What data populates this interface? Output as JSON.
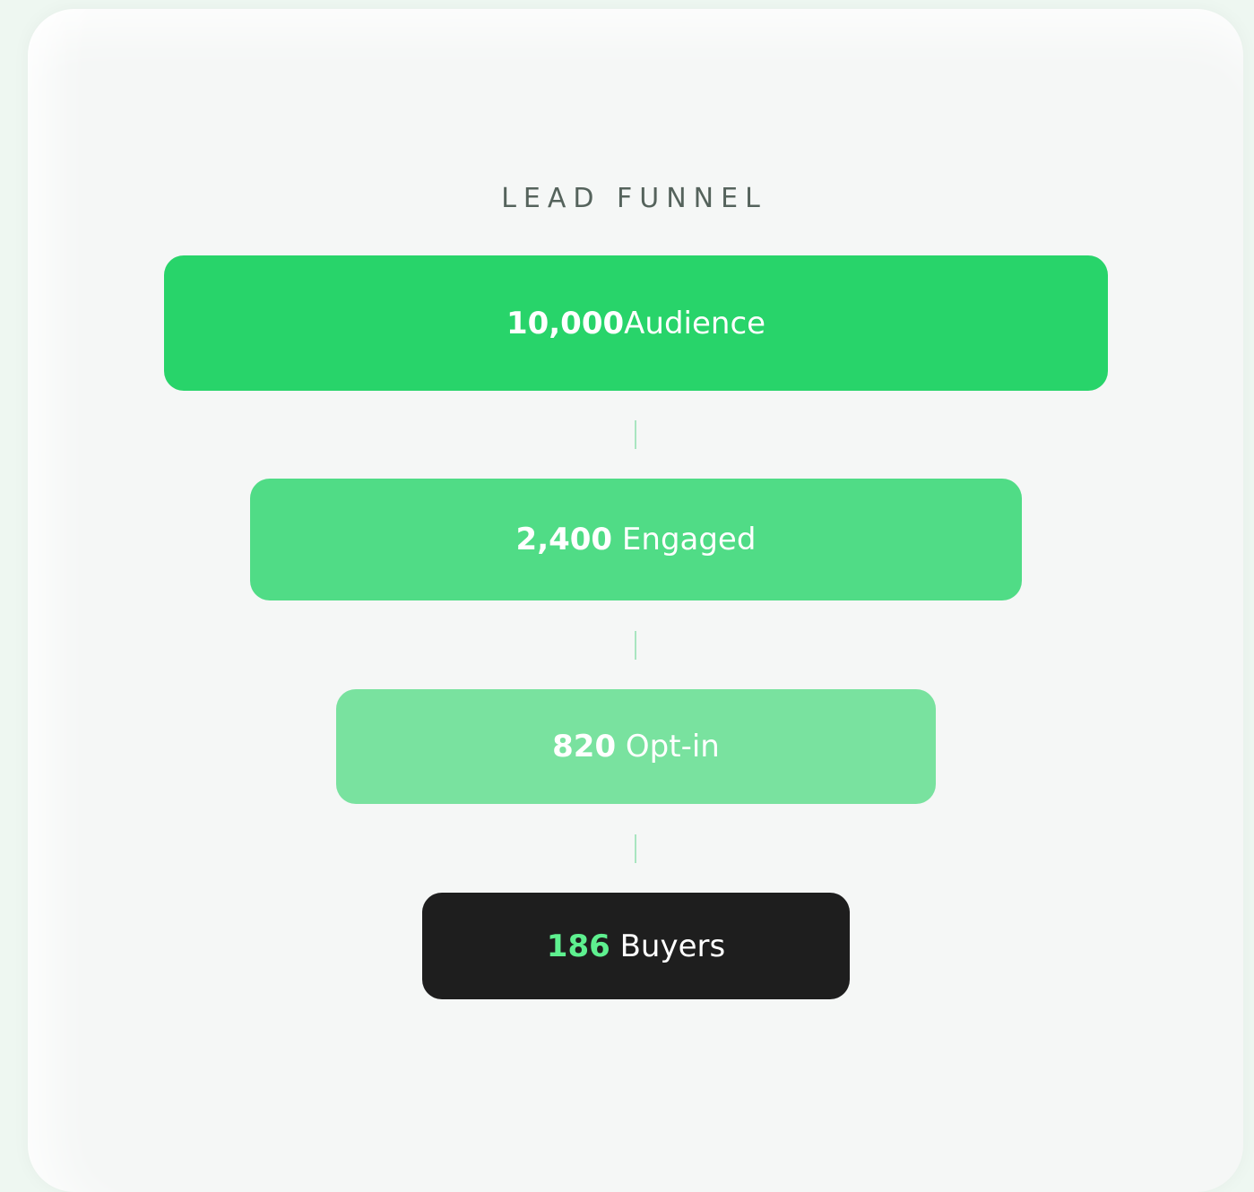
{
  "title": "LEAD FUNNEL",
  "stages": [
    {
      "value": "10,000",
      "label": "Audience"
    },
    {
      "value": "2,400",
      "label": "Engaged"
    },
    {
      "value": "820",
      "label": "Opt-in"
    },
    {
      "value": "186",
      "label": "Buyers"
    }
  ],
  "colors": {
    "stage_1": "#28d46a",
    "stage_2": "#50dc86",
    "stage_3": "#79e29f",
    "stage_4": "#1e1e1e",
    "highlight": "#5ef08f",
    "background": "#f5f7f6"
  }
}
